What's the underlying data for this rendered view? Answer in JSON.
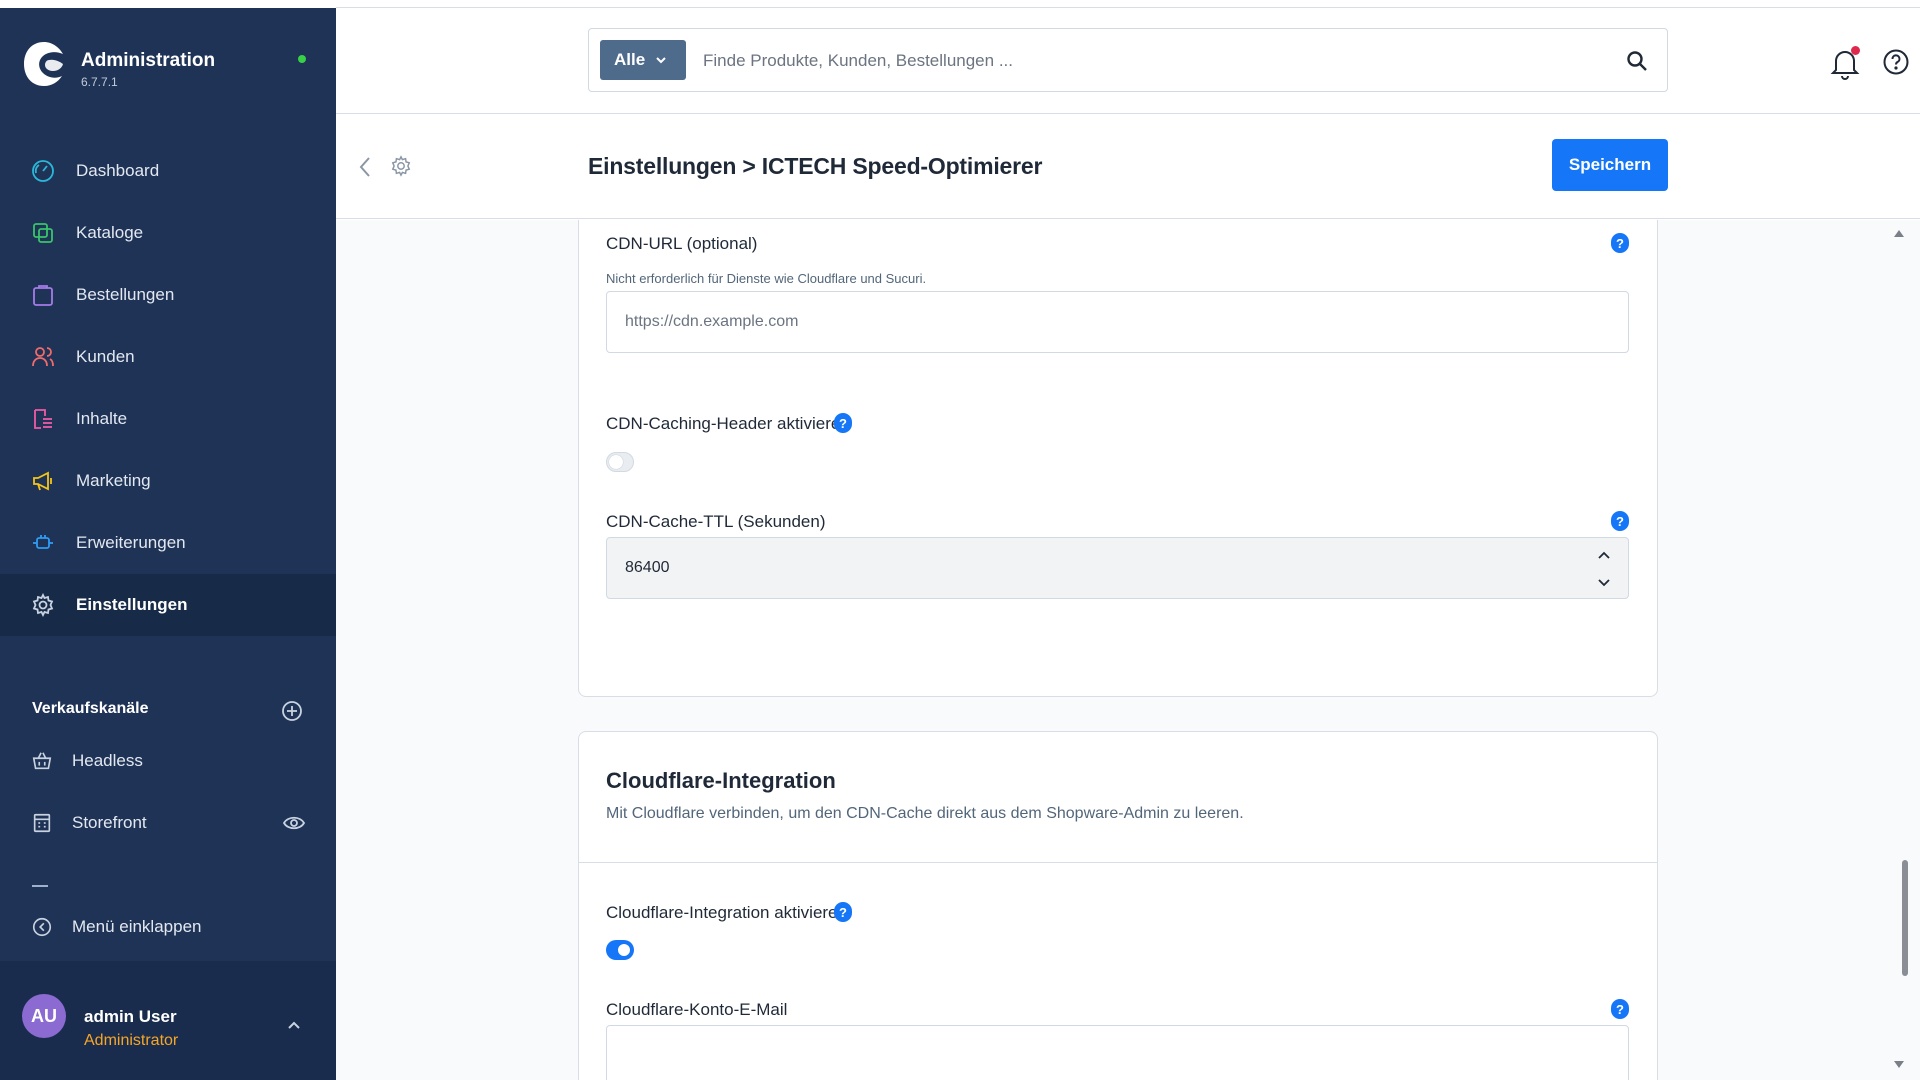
{
  "app": {
    "title": "Administration",
    "version": "6.7.7.1",
    "status_color": "#37d046",
    "sidebar_bg": "#1f3357",
    "accent": "#1576f7"
  },
  "sidebar": {
    "items": [
      {
        "label": "Dashboard",
        "icon": "gauge-icon",
        "active": false
      },
      {
        "label": "Kataloge",
        "icon": "catalog-icon",
        "active": false
      },
      {
        "label": "Bestellungen",
        "icon": "shopping-bag-icon",
        "active": false
      },
      {
        "label": "Kunden",
        "icon": "users-icon",
        "active": false
      },
      {
        "label": "Inhalte",
        "icon": "content-icon",
        "active": false
      },
      {
        "label": "Marketing",
        "icon": "megaphone-icon",
        "active": false
      },
      {
        "label": "Erweiterungen",
        "icon": "plug-icon",
        "active": false
      },
      {
        "label": "Einstellungen",
        "icon": "gear-icon",
        "active": true
      }
    ],
    "channels_title": "Verkaufskanäle",
    "channels": [
      {
        "label": "Headless",
        "icon": "basket-icon"
      },
      {
        "label": "Storefront",
        "icon": "storefront-icon"
      }
    ],
    "collapse_label": "Menü einklappen",
    "user": {
      "initials": "AU",
      "name": "admin User",
      "role": "Administrator"
    }
  },
  "search": {
    "type_label": "Alle",
    "placeholder": "Finde Produkte, Kunden, Bestellungen ..."
  },
  "smartbar": {
    "title": "Einstellungen > ICTECH Speed-Optimierer",
    "save_label": "Speichern"
  },
  "cdn": {
    "url_label": "CDN-URL (optional)",
    "url_hint": "Nicht erforderlich für Dienste wie Cloudflare und Sucuri.",
    "url_placeholder": "https://cdn.example.com",
    "caching_label": "CDN-Caching-Header aktivieren",
    "caching_enabled": false,
    "ttl_label": "CDN-Cache-TTL (Sekunden)",
    "ttl_value": "86400"
  },
  "cloudflare": {
    "title": "Cloudflare-Integration",
    "subtitle": "Mit Cloudflare verbinden, um den CDN-Cache direkt aus dem Shopware-Admin zu leeren.",
    "enable_label": "Cloudflare-Integration aktivieren",
    "enabled": true,
    "email_label": "Cloudflare-Konto-E-Mail",
    "email_value": ""
  }
}
